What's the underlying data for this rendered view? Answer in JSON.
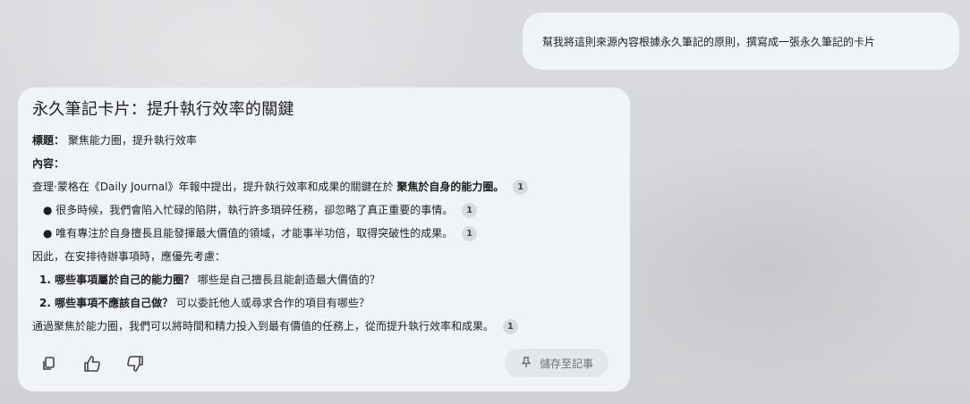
{
  "user_message": "幫我將這則來源內容根據永久筆記的原則，撰寫成一張永久筆記的卡片",
  "card": {
    "title": "永久筆記卡片：提升執行效率的關鍵",
    "heading_label": "標題：",
    "heading_value": "聚焦能力圈，提升執行效率",
    "content_label": "內容：",
    "p1_text": "查理·蒙格在《Daily Journal》年報中提出，提升執行效率和成果的關鍵在於",
    "p1_bold": "聚焦於自身的能力圈。",
    "bullet1": "● 很多時候，我們會陷入忙碌的陷阱，執行許多瑣碎任務，卻忽略了真正重要的事情。",
    "bullet2": "● 唯有專注於自身擅長且能發揮最大價值的領域，才能事半功倍，取得突破性的成果。",
    "p2_text": "因此，在安排待辦事項時，應優先考慮：",
    "item1_bold": "1. 哪些事項屬於自己的能力圈？",
    "item1_text": "哪些是自己擅長且能創造最大價值的？",
    "item2_bold": "2. 哪些事項不應該自己做？",
    "item2_text": "可以委託他人或尋求合作的項目有哪些？",
    "p3_text": "通過聚焦於能力圈，我們可以將時間和精力投入到最有價值的任務上，從而提升執行效率和成果。",
    "citation": "1"
  },
  "actions": {
    "copy_icon": "copy-icon",
    "thumbs_up_icon": "thumbs-up-icon",
    "thumbs_down_icon": "thumbs-down-icon",
    "save_label": "儲存至記事",
    "save_icon": "pin-icon"
  }
}
